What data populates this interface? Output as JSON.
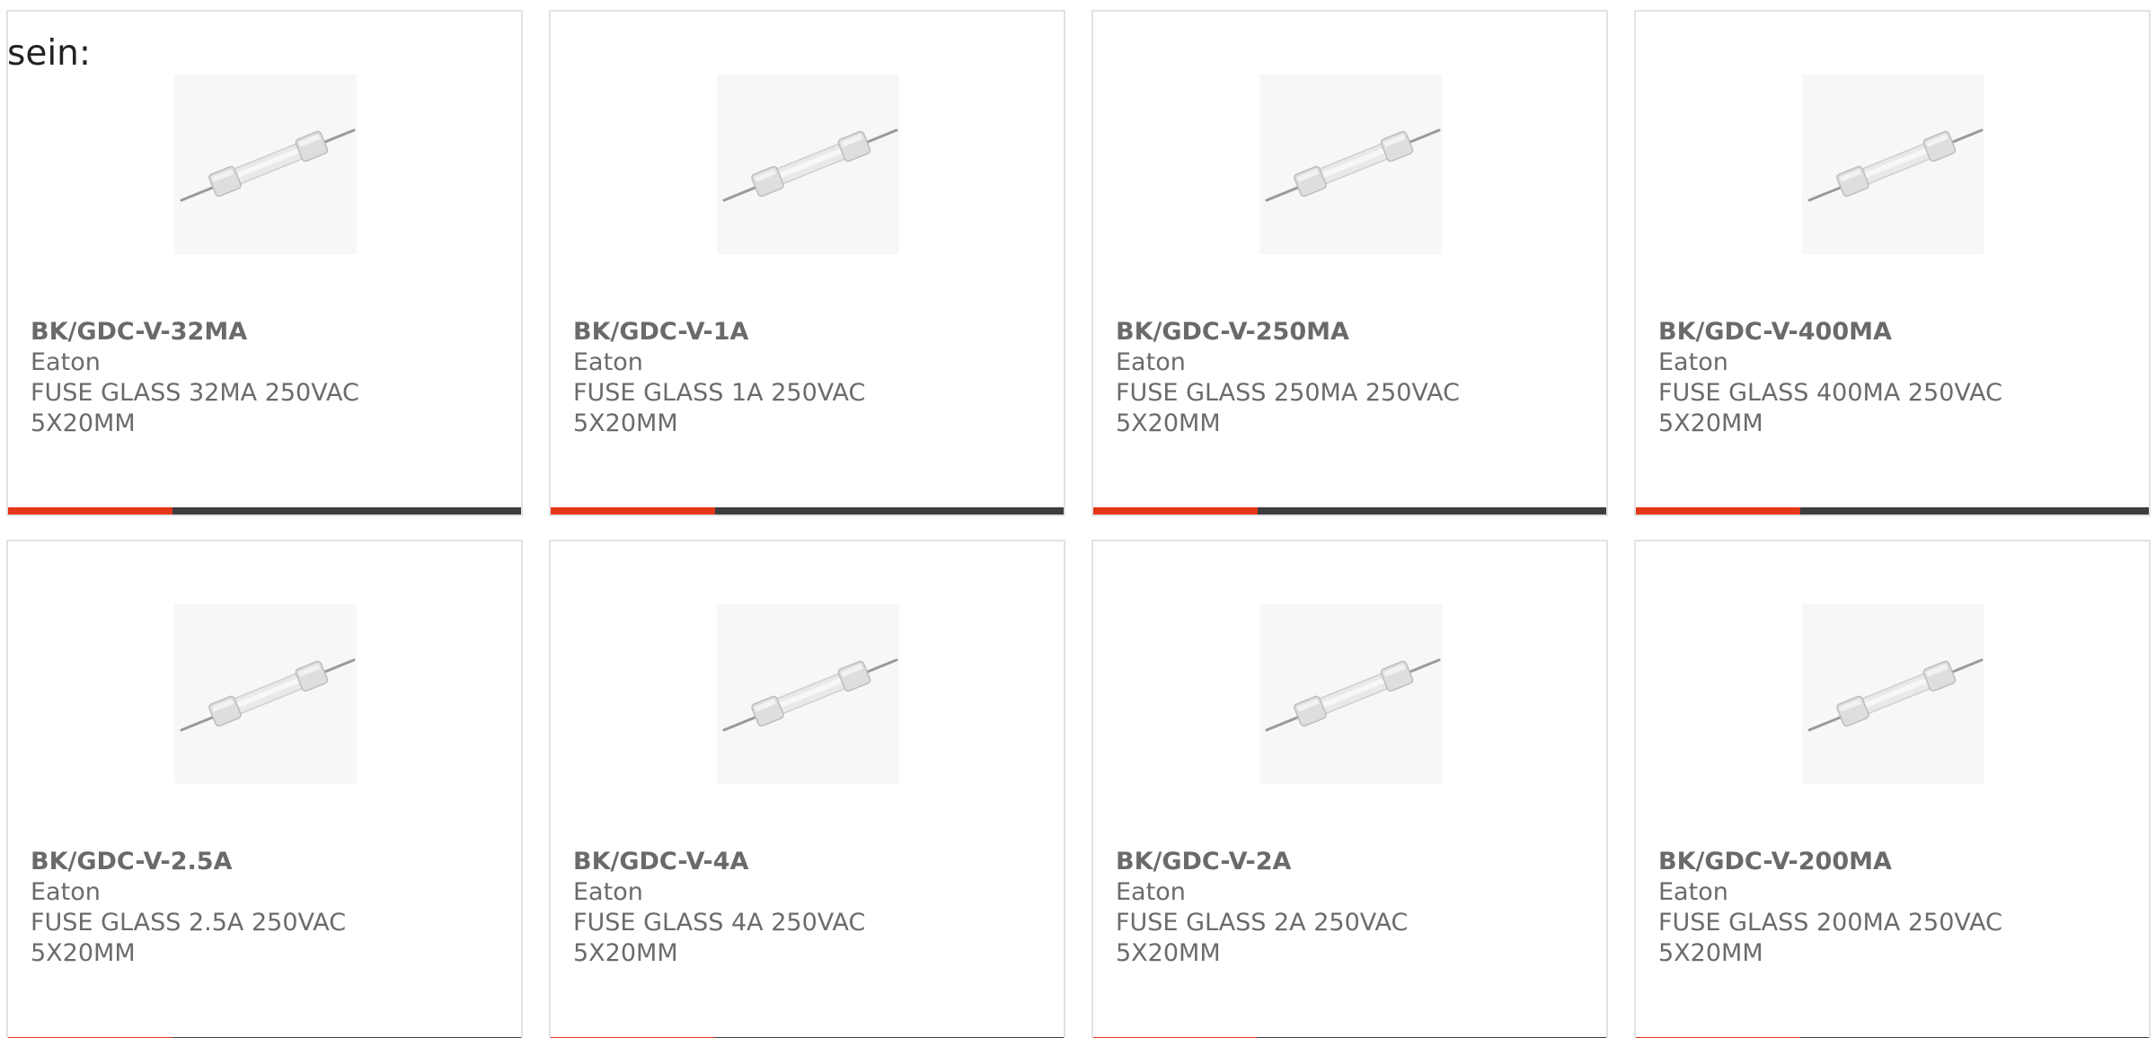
{
  "lead_text": "sein:",
  "colors": {
    "accent": "#e5361a",
    "bar": "#3e3e3e",
    "card_border": "#e2e2e2",
    "text": "#6b6b6b"
  },
  "products": [
    {
      "part_no": "BK/GDC-V-32MA",
      "maker": "Eaton",
      "description": "FUSE GLASS 32MA 250VAC 5X20MM",
      "image_icon": "glass-fuse-image",
      "accent_fraction": 0.32
    },
    {
      "part_no": "BK/GDC-V-1A",
      "maker": "Eaton",
      "description": "FUSE GLASS 1A 250VAC 5X20MM",
      "image_icon": "glass-fuse-image",
      "accent_fraction": 0.32
    },
    {
      "part_no": "BK/GDC-V-250MA",
      "maker": "Eaton",
      "description": "FUSE GLASS 250MA 250VAC 5X20MM",
      "image_icon": "glass-fuse-image",
      "accent_fraction": 0.32
    },
    {
      "part_no": "BK/GDC-V-400MA",
      "maker": "Eaton",
      "description": "FUSE GLASS 400MA 250VAC 5X20MM",
      "image_icon": "glass-fuse-image",
      "accent_fraction": 0.32
    },
    {
      "part_no": "BK/GDC-V-2.5A",
      "maker": "Eaton",
      "description": "FUSE GLASS 2.5A 250VAC 5X20MM",
      "image_icon": "glass-fuse-image",
      "accent_fraction": 0.32
    },
    {
      "part_no": "BK/GDC-V-4A",
      "maker": "Eaton",
      "description": "FUSE GLASS 4A 250VAC 5X20MM",
      "image_icon": "glass-fuse-image",
      "accent_fraction": 0.32
    },
    {
      "part_no": "BK/GDC-V-2A",
      "maker": "Eaton",
      "description": "FUSE GLASS 2A 250VAC 5X20MM",
      "image_icon": "glass-fuse-image",
      "accent_fraction": 0.32
    },
    {
      "part_no": "BK/GDC-V-200MA",
      "maker": "Eaton",
      "description": "FUSE GLASS 200MA 250VAC 5X20MM",
      "image_icon": "glass-fuse-image",
      "accent_fraction": 0.32
    }
  ]
}
